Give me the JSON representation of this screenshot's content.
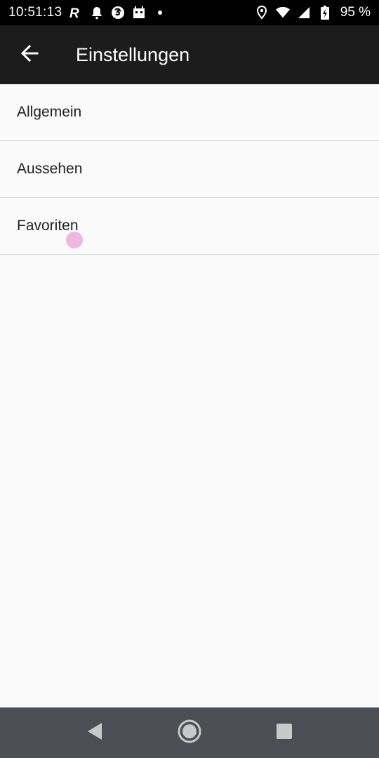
{
  "status_bar": {
    "time": "10:51:13",
    "battery": "95 %",
    "icons": [
      "r-app-icon",
      "bell-icon",
      "firefox-icon",
      "robot-icon",
      "dot-icon",
      "location-icon",
      "wifi-icon",
      "signal-icon",
      "battery-icon"
    ]
  },
  "toolbar": {
    "title": "Einstellungen",
    "back_icon": "arrow-back-icon",
    "background": "#1c1c1c"
  },
  "settings": {
    "items": [
      {
        "label": "Allgemein"
      },
      {
        "label": "Aussehen"
      },
      {
        "label": "Favoriten"
      }
    ]
  },
  "navigation_bar": {
    "buttons": [
      "back-triangle-icon",
      "home-circle-icon",
      "recents-square-icon"
    ],
    "background": "#4b4e53"
  },
  "colors": {
    "page_background": "#fafafa",
    "divider": "#d9d9d9",
    "text": "#212121"
  }
}
